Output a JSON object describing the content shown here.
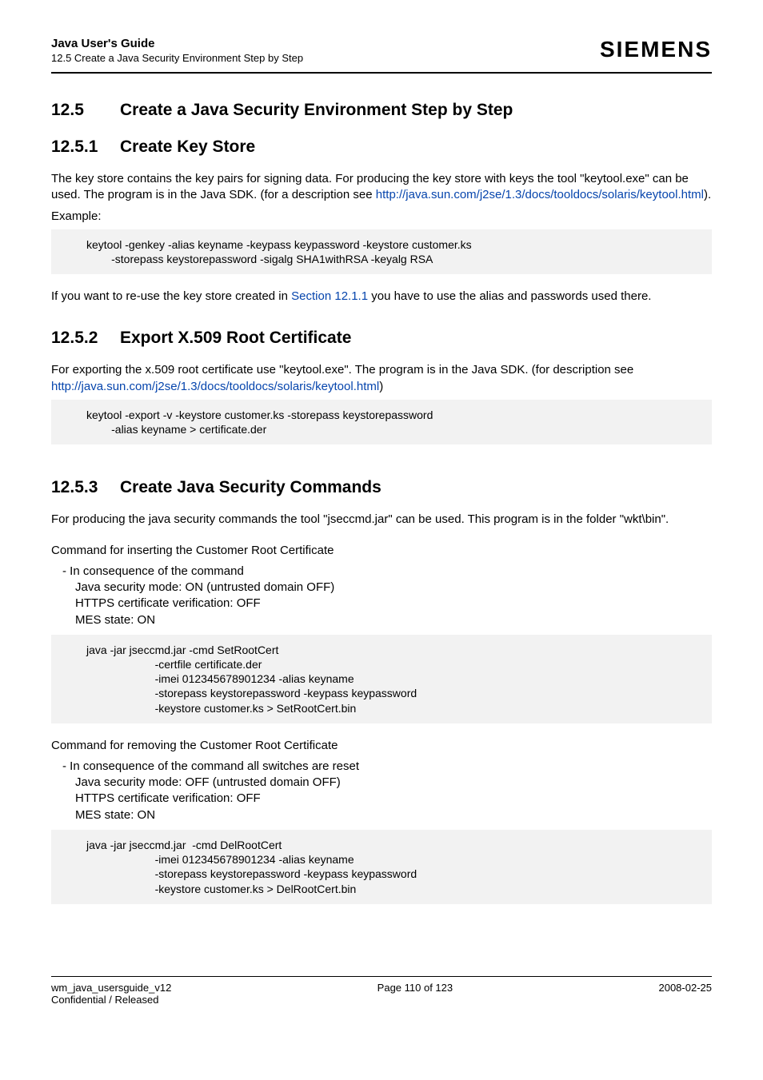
{
  "header": {
    "title": "Java User's Guide",
    "sub": "12.5 Create a Java Security Environment Step by Step",
    "brand": "SIEMENS"
  },
  "section": {
    "num125": "12.5",
    "title125": "Create a Java Security Environment Step by Step",
    "num1251": "12.5.1",
    "title1251": "Create Key Store",
    "para1251a_pre": "The key store contains the key pairs for signing data. For producing the key store with keys the tool \"keytool.exe\" can be used. The program is in the Java SDK. (for a description see ",
    "link1251": "http://java.sun.com/j2se/1.3/docs/tooldocs/solaris/keytool.html",
    "para1251a_post": ").",
    "para1251b": "Example:",
    "code1251": "keytool -genkey -alias keyname -keypass keypassword -keystore customer.ks\n        -storepass keystorepassword -sigalg SHA1withRSA -keyalg RSA",
    "para1251c_pre": "If you want to re-use the key store created in ",
    "link1251b": "Section 12.1.1",
    "para1251c_post": " you have to use the alias and passwords used there.",
    "num1252": "12.5.2",
    "title1252": "Export X.509 Root Certificate",
    "para1252_pre": "For exporting the x.509 root certificate use \"keytool.exe\". The program is in the Java SDK. (for description see ",
    "link1252": "http://java.sun.com/j2se/1.3/docs/tooldocs/solaris/keytool.html",
    "para1252_post": ")",
    "code1252": "keytool -export -v -keystore customer.ks -storepass keystorepassword\n        -alias keyname > certificate.der",
    "num1253": "12.5.3",
    "title1253": "Create Java Security Commands",
    "para1253a": "For producing the java security commands the tool \"jseccmd.jar\" can be used. This program is in the folder \"wkt\\bin\".",
    "para1253b": "Command for inserting the Customer Root Certificate",
    "bullet1_l1": "In consequence of the command",
    "bullet1_l2": "Java security mode: ON (untrusted domain OFF)",
    "bullet1_l3": "HTTPS certificate verification: OFF",
    "bullet1_l4": "MES state: ON",
    "code1253a": "java -jar jseccmd.jar -cmd SetRootCert\n                      -certfile certificate.der\n                      -imei 012345678901234 -alias keyname\n                      -storepass keystorepassword -keypass keypassword\n                      -keystore customer.ks > SetRootCert.bin",
    "para1253c": "Command for removing the Customer Root Certificate",
    "bullet2_l1": "In consequence of the command all switches are reset",
    "bullet2_l2": "Java security mode: OFF (untrusted domain OFF)",
    "bullet2_l3": "HTTPS certificate verification: OFF",
    "bullet2_l4": "MES state: ON",
    "code1253b": "java -jar jseccmd.jar  -cmd DelRootCert\n                      -imei 012345678901234 -alias keyname\n                      -storepass keystorepassword -keypass keypassword\n                      -keystore customer.ks > DelRootCert.bin"
  },
  "footer": {
    "left1": "wm_java_usersguide_v12",
    "left2": "Confidential / Released",
    "center": "Page 110 of 123",
    "right": "2008-02-25"
  }
}
